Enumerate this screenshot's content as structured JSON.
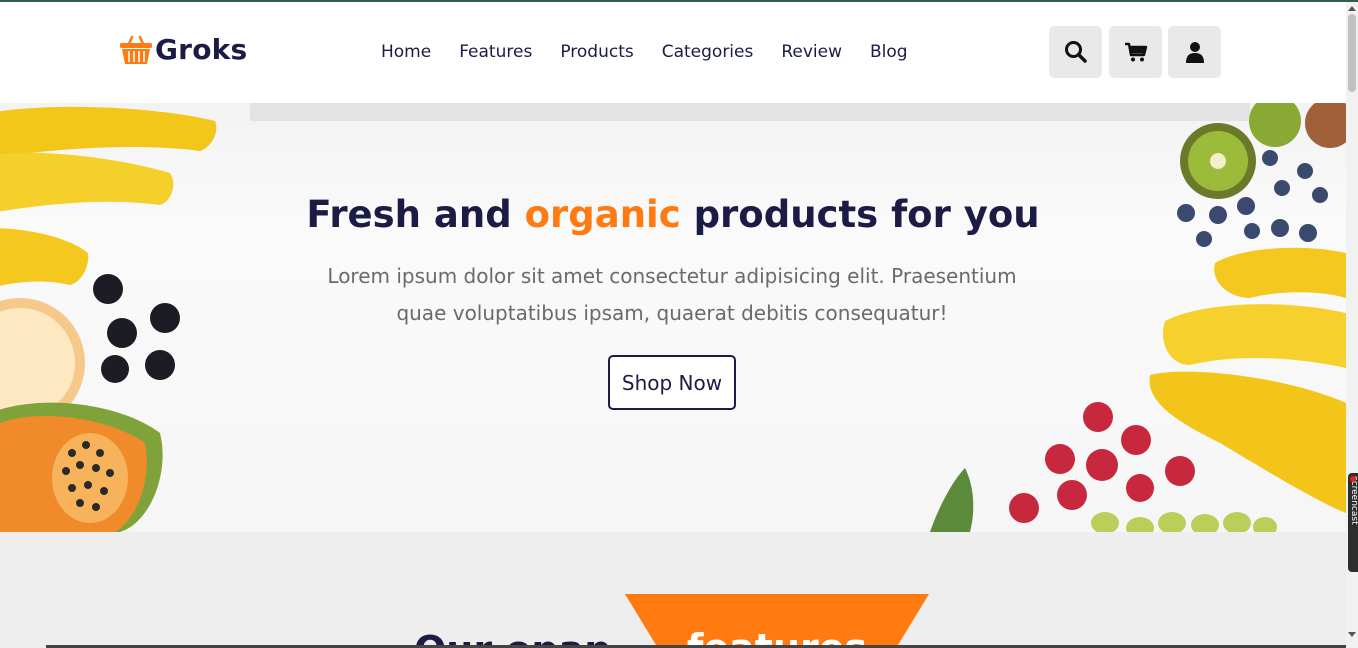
{
  "brand": {
    "name": "Groks",
    "accent_color": "#ff7a11",
    "dark_color": "#1a1c46"
  },
  "nav": {
    "items": [
      {
        "label": "Home"
      },
      {
        "label": "Features"
      },
      {
        "label": "Products"
      },
      {
        "label": "Categories"
      },
      {
        "label": "Review"
      },
      {
        "label": "Blog"
      }
    ]
  },
  "header_icons": [
    "search-icon",
    "cart-icon",
    "user-icon"
  ],
  "hero": {
    "title_part1": "Fresh and",
    "title_accent": "organic",
    "title_part2": "products for you",
    "subtitle": "Lorem ipsum dolor sit amet consectetur adipisicing elit. Praesentium quae voluptatibus ipsam, quaerat debitis consequatur!",
    "button_label": "Shop Now"
  },
  "features": {
    "heading": "Our opap",
    "tag": "features"
  },
  "side_badge": "screencast"
}
